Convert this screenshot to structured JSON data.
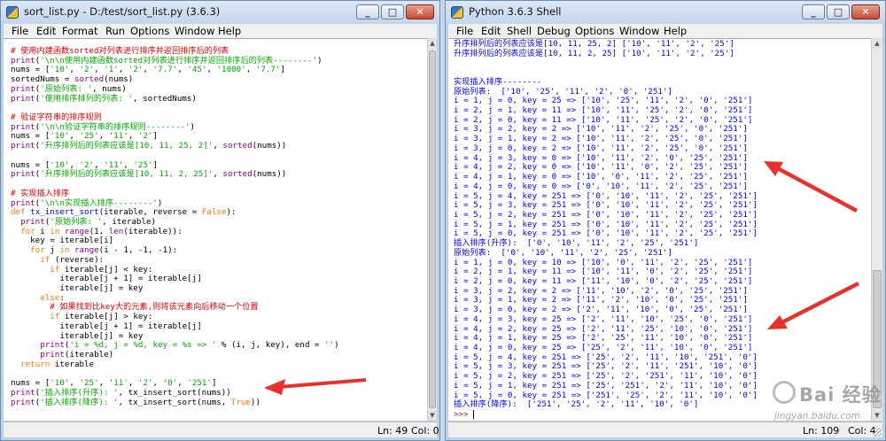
{
  "left_window": {
    "title": "sort_list.py - D:/test/sort_list.py (3.6.3)",
    "menu": [
      "File",
      "Edit",
      "Format",
      "Run",
      "Options",
      "Window",
      "Help"
    ],
    "code_lines": [
      [
        {
          "t": "# 使用内建函数sorted对列表进行排序并返回排序后的列表",
          "c": "comment"
        }
      ],
      [
        {
          "t": "print",
          "c": "builtin"
        },
        {
          "t": "(",
          "c": "plain"
        },
        {
          "t": "'\\n\\n使用内建函数sorted对列表进行排序并返回排序后的列表--------'",
          "c": "str"
        },
        {
          "t": ")",
          "c": "plain"
        }
      ],
      [
        {
          "t": "nums = [",
          "c": "plain"
        },
        {
          "t": "'10'",
          "c": "str"
        },
        {
          "t": ", ",
          "c": "plain"
        },
        {
          "t": "'2'",
          "c": "str"
        },
        {
          "t": ", ",
          "c": "plain"
        },
        {
          "t": "'1'",
          "c": "str"
        },
        {
          "t": ", ",
          "c": "plain"
        },
        {
          "t": "'2'",
          "c": "str"
        },
        {
          "t": ", ",
          "c": "plain"
        },
        {
          "t": "'7.7'",
          "c": "str"
        },
        {
          "t": ", ",
          "c": "plain"
        },
        {
          "t": "'45'",
          "c": "str"
        },
        {
          "t": ", ",
          "c": "plain"
        },
        {
          "t": "'1000'",
          "c": "str"
        },
        {
          "t": ", ",
          "c": "plain"
        },
        {
          "t": "'7.7'",
          "c": "str"
        },
        {
          "t": "]",
          "c": "plain"
        }
      ],
      [
        {
          "t": "sortedNums = ",
          "c": "plain"
        },
        {
          "t": "sorted",
          "c": "builtin"
        },
        {
          "t": "(nums)",
          "c": "plain"
        }
      ],
      [
        {
          "t": "print",
          "c": "builtin"
        },
        {
          "t": "(",
          "c": "plain"
        },
        {
          "t": "'原始列表: '",
          "c": "str"
        },
        {
          "t": ", nums)",
          "c": "plain"
        }
      ],
      [
        {
          "t": "print",
          "c": "builtin"
        },
        {
          "t": "(",
          "c": "plain"
        },
        {
          "t": "'使用排序排列的列表: '",
          "c": "str"
        },
        {
          "t": ", sortedNums)",
          "c": "plain"
        }
      ],
      [],
      [
        {
          "t": "# 验证字符串的排序规则",
          "c": "comment"
        }
      ],
      [
        {
          "t": "print",
          "c": "builtin"
        },
        {
          "t": "(",
          "c": "plain"
        },
        {
          "t": "'\\n\\n验证字符串的排序规则--------'",
          "c": "str"
        },
        {
          "t": ")",
          "c": "plain"
        }
      ],
      [
        {
          "t": "nums = [",
          "c": "plain"
        },
        {
          "t": "'10'",
          "c": "str"
        },
        {
          "t": ", ",
          "c": "plain"
        },
        {
          "t": "'25'",
          "c": "str"
        },
        {
          "t": ", ",
          "c": "plain"
        },
        {
          "t": "'11'",
          "c": "str"
        },
        {
          "t": ", ",
          "c": "plain"
        },
        {
          "t": "'2'",
          "c": "str"
        },
        {
          "t": "]",
          "c": "plain"
        }
      ],
      [
        {
          "t": "print",
          "c": "builtin"
        },
        {
          "t": "(",
          "c": "plain"
        },
        {
          "t": "'升序排列后的列表应该是[10, 11, 25, 2]'",
          "c": "str"
        },
        {
          "t": ", ",
          "c": "plain"
        },
        {
          "t": "sorted",
          "c": "builtin"
        },
        {
          "t": "(nums))",
          "c": "plain"
        }
      ],
      [],
      [
        {
          "t": "nums = [",
          "c": "plain"
        },
        {
          "t": "'10'",
          "c": "str"
        },
        {
          "t": ", ",
          "c": "plain"
        },
        {
          "t": "'2'",
          "c": "str"
        },
        {
          "t": ", ",
          "c": "plain"
        },
        {
          "t": "'11'",
          "c": "str"
        },
        {
          "t": ", ",
          "c": "plain"
        },
        {
          "t": "'25'",
          "c": "str"
        },
        {
          "t": "]",
          "c": "plain"
        }
      ],
      [
        {
          "t": "print",
          "c": "builtin"
        },
        {
          "t": "(",
          "c": "plain"
        },
        {
          "t": "'升序排列后的列表应该是[10, 11, 2, 25]'",
          "c": "str"
        },
        {
          "t": ", ",
          "c": "plain"
        },
        {
          "t": "sorted",
          "c": "builtin"
        },
        {
          "t": "(nums))",
          "c": "plain"
        }
      ],
      [],
      [
        {
          "t": "# 实现插入排序",
          "c": "comment"
        }
      ],
      [
        {
          "t": "print",
          "c": "builtin"
        },
        {
          "t": "(",
          "c": "plain"
        },
        {
          "t": "'\\n\\n实现插入排序--------'",
          "c": "str"
        },
        {
          "t": ")",
          "c": "plain"
        }
      ],
      [
        {
          "t": "def",
          "c": "kw"
        },
        {
          "t": " ",
          "c": "plain"
        },
        {
          "t": "tx_insert_sort",
          "c": "def"
        },
        {
          "t": "(iterable, reverse = ",
          "c": "plain"
        },
        {
          "t": "False",
          "c": "kw"
        },
        {
          "t": "):",
          "c": "plain"
        }
      ],
      [
        {
          "t": "  ",
          "c": "plain"
        },
        {
          "t": "print",
          "c": "builtin"
        },
        {
          "t": "(",
          "c": "plain"
        },
        {
          "t": "'原始列表: '",
          "c": "str"
        },
        {
          "t": ", iterable)",
          "c": "plain"
        }
      ],
      [
        {
          "t": "  ",
          "c": "plain"
        },
        {
          "t": "for",
          "c": "kw"
        },
        {
          "t": " i ",
          "c": "plain"
        },
        {
          "t": "in",
          "c": "kw"
        },
        {
          "t": " ",
          "c": "plain"
        },
        {
          "t": "range",
          "c": "builtin"
        },
        {
          "t": "(1, ",
          "c": "plain"
        },
        {
          "t": "len",
          "c": "builtin"
        },
        {
          "t": "(iterable)):",
          "c": "plain"
        }
      ],
      [
        {
          "t": "    key = iterable[i]",
          "c": "plain"
        }
      ],
      [
        {
          "t": "    ",
          "c": "plain"
        },
        {
          "t": "for",
          "c": "kw"
        },
        {
          "t": " j ",
          "c": "plain"
        },
        {
          "t": "in",
          "c": "kw"
        },
        {
          "t": " ",
          "c": "plain"
        },
        {
          "t": "range",
          "c": "builtin"
        },
        {
          "t": "(i - 1, -1, -1):",
          "c": "plain"
        }
      ],
      [
        {
          "t": "      ",
          "c": "plain"
        },
        {
          "t": "if",
          "c": "kw"
        },
        {
          "t": " (reverse):",
          "c": "plain"
        }
      ],
      [
        {
          "t": "        ",
          "c": "plain"
        },
        {
          "t": "if",
          "c": "kw"
        },
        {
          "t": " iterable[j] < key:",
          "c": "plain"
        }
      ],
      [
        {
          "t": "          iterable[j + 1] = iterable[j]",
          "c": "plain"
        }
      ],
      [
        {
          "t": "          iterable[j] = key",
          "c": "plain"
        }
      ],
      [
        {
          "t": "      ",
          "c": "plain"
        },
        {
          "t": "else",
          "c": "kw"
        },
        {
          "t": ":",
          "c": "plain"
        }
      ],
      [
        {
          "t": "        ",
          "c": "plain"
        },
        {
          "t": "# 如果找到比key大的元素,则将该元素向后移动一个位置",
          "c": "comment"
        }
      ],
      [
        {
          "t": "        ",
          "c": "plain"
        },
        {
          "t": "if",
          "c": "kw"
        },
        {
          "t": " iterable[j] > key:",
          "c": "plain"
        }
      ],
      [
        {
          "t": "          iterable[j + 1] = iterable[j]",
          "c": "plain"
        }
      ],
      [
        {
          "t": "          iterable[j] = key",
          "c": "plain"
        }
      ],
      [
        {
          "t": "      ",
          "c": "plain"
        },
        {
          "t": "print",
          "c": "builtin"
        },
        {
          "t": "(",
          "c": "plain"
        },
        {
          "t": "'i = %d, j = %d, key = %s => '",
          "c": "str"
        },
        {
          "t": " % (i, j, key), end = ",
          "c": "plain"
        },
        {
          "t": "''",
          "c": "str"
        },
        {
          "t": ")",
          "c": "plain"
        }
      ],
      [
        {
          "t": "      ",
          "c": "plain"
        },
        {
          "t": "print",
          "c": "builtin"
        },
        {
          "t": "(iterable)",
          "c": "plain"
        }
      ],
      [
        {
          "t": "  ",
          "c": "plain"
        },
        {
          "t": "return",
          "c": "kw"
        },
        {
          "t": " iterable",
          "c": "plain"
        }
      ],
      [],
      [
        {
          "t": "nums = [",
          "c": "plain"
        },
        {
          "t": "'10'",
          "c": "str"
        },
        {
          "t": ", ",
          "c": "plain"
        },
        {
          "t": "'25'",
          "c": "str"
        },
        {
          "t": ", ",
          "c": "plain"
        },
        {
          "t": "'11'",
          "c": "str"
        },
        {
          "t": ", ",
          "c": "plain"
        },
        {
          "t": "'2'",
          "c": "str"
        },
        {
          "t": ", ",
          "c": "plain"
        },
        {
          "t": "'0'",
          "c": "str"
        },
        {
          "t": ", ",
          "c": "plain"
        },
        {
          "t": "'251'",
          "c": "str"
        },
        {
          "t": "]",
          "c": "plain"
        }
      ],
      [
        {
          "t": "print",
          "c": "builtin"
        },
        {
          "t": "(",
          "c": "plain"
        },
        {
          "t": "'插入排序(升序): '",
          "c": "str"
        },
        {
          "t": ", tx_insert_sort(nums))",
          "c": "plain"
        }
      ],
      [
        {
          "t": "print",
          "c": "builtin"
        },
        {
          "t": "(",
          "c": "plain"
        },
        {
          "t": "'插入排序(降序): '",
          "c": "str"
        },
        {
          "t": ", tx_insert_sort(nums, ",
          "c": "plain"
        },
        {
          "t": "True",
          "c": "kw"
        },
        {
          "t": "))",
          "c": "plain"
        }
      ]
    ],
    "status": {
      "ln": "Ln: 49",
      "col": "Col: 0"
    }
  },
  "right_window": {
    "title": "Python 3.6.3 Shell",
    "menu": [
      "File",
      "Edit",
      "Shell",
      "Debug",
      "Options",
      "Window",
      "Help"
    ],
    "output_lines": [
      "升序排列后的列表应该是[10, 11, 25, 2] ['10', '11', '2', '25']",
      "升序排列后的列表应该是[10, 11, 2, 25] ['10', '11', '2', '25']",
      "",
      "",
      "实现插入排序--------",
      "原始列表:  ['10', '25', '11', '2', '0', '251']",
      "i = 1, j = 0, key = 25 => ['10', '25', '11', '2', '0', '251']",
      "i = 2, j = 1, key = 11 => ['10', '11', '25', '2', '0', '251']",
      "i = 2, j = 0, key = 11 => ['10', '11', '25', '2', '0', '251']",
      "i = 3, j = 2, key = 2 => ['10', '11', '2', '25', '0', '251']",
      "i = 3, j = 1, key = 2 => ['10', '11', '2', '25', '0', '251']",
      "i = 3, j = 0, key = 2 => ['10', '11', '2', '25', '0', '251']",
      "i = 4, j = 3, key = 0 => ['10', '11', '2', '0', '25', '251']",
      "i = 4, j = 2, key = 0 => ['10', '11', '0', '2', '25', '251']",
      "i = 4, j = 1, key = 0 => ['10', '0', '11', '2', '25', '251']",
      "i = 4, j = 0, key = 0 => ['0', '10', '11', '2', '25', '251']",
      "i = 5, j = 4, key = 251 => ['0', '10', '11', '2', '25', '251']",
      "i = 5, j = 3, key = 251 => ['0', '10', '11', '2', '25', '251']",
      "i = 5, j = 2, key = 251 => ['0', '10', '11', '2', '25', '251']",
      "i = 5, j = 1, key = 251 => ['0', '10', '11', '2', '25', '251']",
      "i = 5, j = 0, key = 251 => ['0', '10', '11', '2', '25', '251']",
      "插入排序(升序):  ['0', '10', '11', '2', '25', '251']",
      "原始列表:  ['0', '10', '11', '2', '25', '251']",
      "i = 1, j = 0, key = 10 => ['10', '0', '11', '2', '25', '251']",
      "i = 2, j = 1, key = 11 => ['10', '11', '0', '2', '25', '251']",
      "i = 2, j = 0, key = 11 => ['11', '10', '0', '2', '25', '251']",
      "i = 3, j = 2, key = 2 => ['11', '10', '2', '0', '25', '251']",
      "i = 3, j = 1, key = 2 => ['11', '2', '10', '0', '25', '251']",
      "i = 3, j = 0, key = 2 => ['2', '11', '10', '0', '25', '251']",
      "i = 4, j = 3, key = 25 => ['2', '11', '10', '25', '0', '251']",
      "i = 4, j = 2, key = 25 => ['2', '11', '25', '10', '0', '251']",
      "i = 4, j = 1, key = 25 => ['2', '25', '11', '10', '0', '251']",
      "i = 4, j = 0, key = 25 => ['25', '2', '11', '10', '0', '251']",
      "i = 5, j = 4, key = 251 => ['25', '2', '11', '10', '251', '0']",
      "i = 5, j = 3, key = 251 => ['25', '2', '11', '251', '10', '0']",
      "i = 5, j = 2, key = 251 => ['25', '2', '251', '11', '10', '0']",
      "i = 5, j = 1, key = 251 => ['25', '251', '2', '11', '10', '0']",
      "i = 5, j = 0, key = 251 => ['251', '25', '2', '11', '10', '0']",
      "插入排序(降序):  ['251', '25', '2', '11', '10', '0']"
    ],
    "prompt": ">>> ",
    "status": {
      "ln": "Ln: 109",
      "col": "Col: 4"
    }
  },
  "watermark": {
    "brand": "Bai 经验",
    "url": "jingyan.baidu.com"
  },
  "colors": {
    "comment": "#dd0000",
    "keyword": "#ff7700",
    "string": "#00aa00",
    "builtin": "#900090",
    "definition": "#0000ff",
    "shell_output": "#0000ff",
    "annotation_arrow": "#e8312a"
  },
  "icons": {
    "window_controls": [
      "minimize-icon",
      "maximize-icon",
      "close-icon"
    ]
  }
}
